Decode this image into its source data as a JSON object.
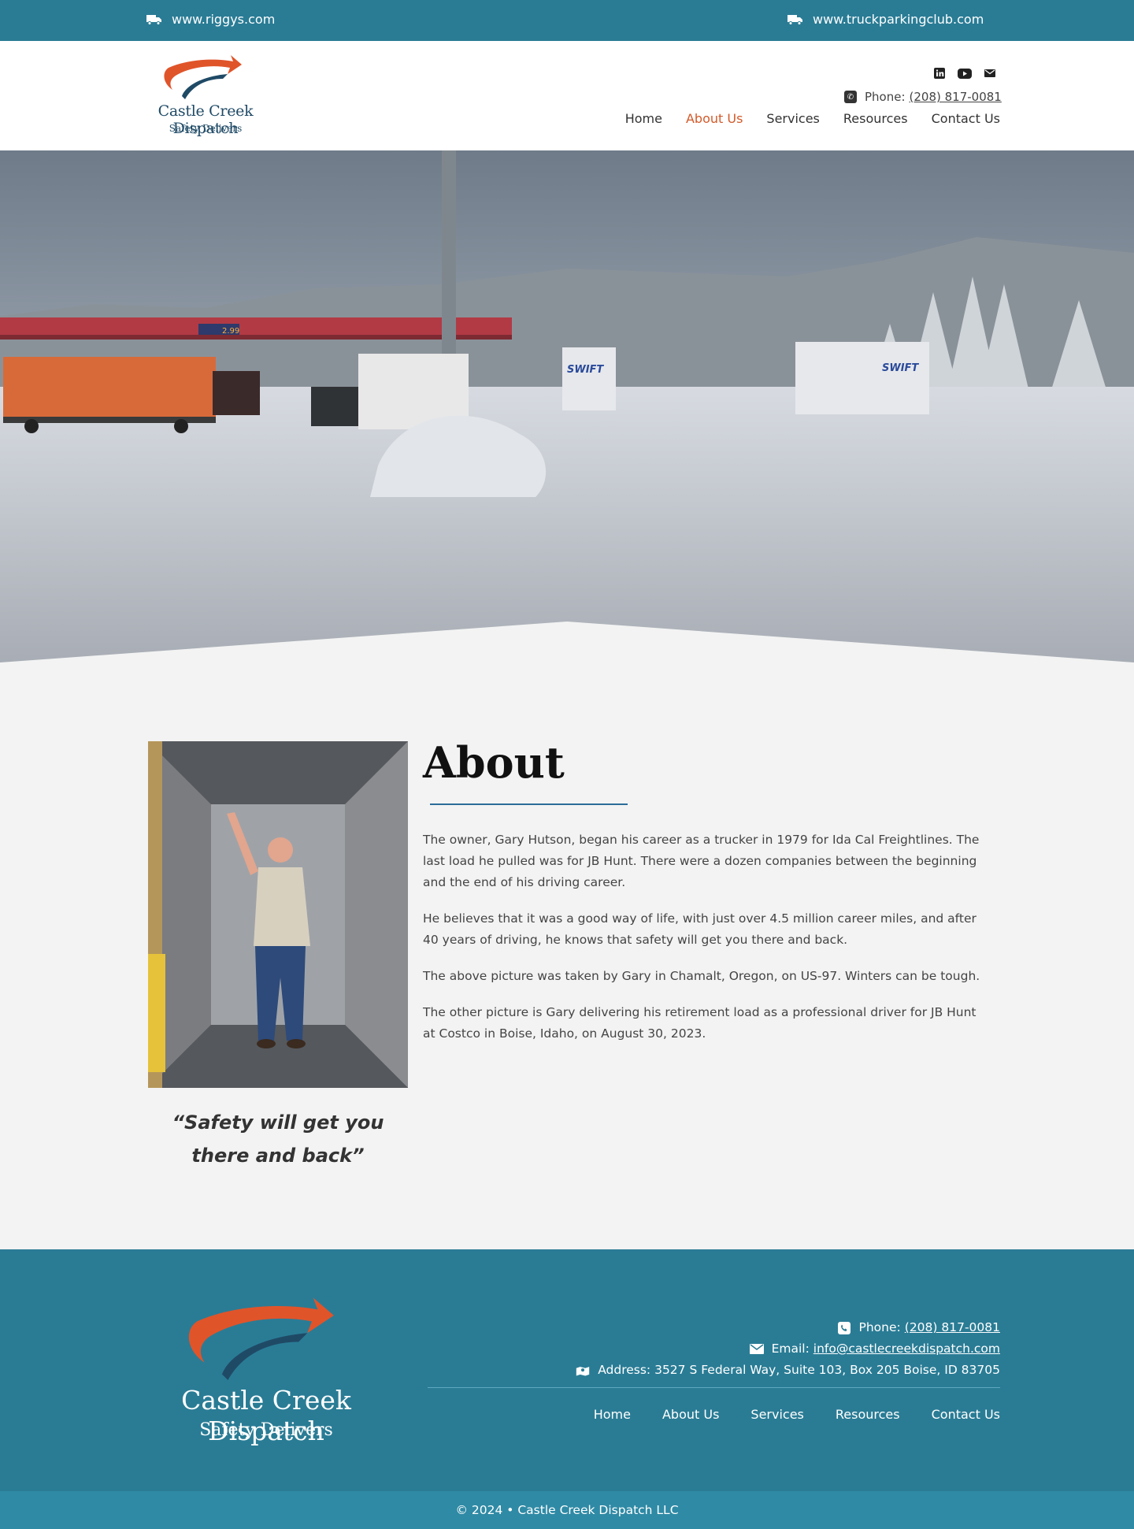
{
  "topbar": {
    "left_link": "www.riggys.com",
    "right_link": "www.truckparkingclub.com",
    "icon": "truck-icon"
  },
  "brand": {
    "name": "Castle Creek Dispatch",
    "tagline": "Safety Delivers",
    "colors": {
      "orange": "#e0542a",
      "navy": "#1f4a66",
      "teal": "#2a7c95"
    }
  },
  "header": {
    "social": [
      "linkedin-icon",
      "youtube-icon",
      "email-icon"
    ],
    "phone_label": "Phone:",
    "phone_number": "(208) 817-0081"
  },
  "nav": {
    "items": [
      "Home",
      "About Us",
      "Services",
      "Resources",
      "Contact Us"
    ],
    "active": "About Us"
  },
  "about": {
    "title": "About",
    "quote": "“Safety will get you there and back”",
    "paragraphs": [
      "The owner, Gary Hutson, began his career as a trucker in 1979 for Ida Cal Freightlines. The last load he pulled was for JB Hunt. There were a dozen companies between the beginning and the end of his driving career.",
      "He believes that it was a good way of life, with just over 4.5 million career miles, and after 40 years of driving, he knows that safety will get you there and back.",
      "The above picture was taken by Gary in Chamalt, Oregon, on US-97. Winters can be tough.",
      "The other picture is Gary delivering his retirement load as a professional driver for JB Hunt at Costco in Boise, Idaho, on August 30, 2023."
    ]
  },
  "hero": {
    "price_sign": "2.99"
  },
  "footer": {
    "phone_label": "Phone:",
    "phone_number": "(208) 817-0081",
    "email_label": "Email:",
    "email": "info@castlecreekdispatch.com",
    "address": "Address: 3527 S Federal Way, Suite 103, Box 205 Boise, ID 83705",
    "nav": [
      "Home",
      "About Us",
      "Services",
      "Resources",
      "Contact Us"
    ],
    "copyright": "© 2024 • Castle Creek Dispatch LLC"
  }
}
